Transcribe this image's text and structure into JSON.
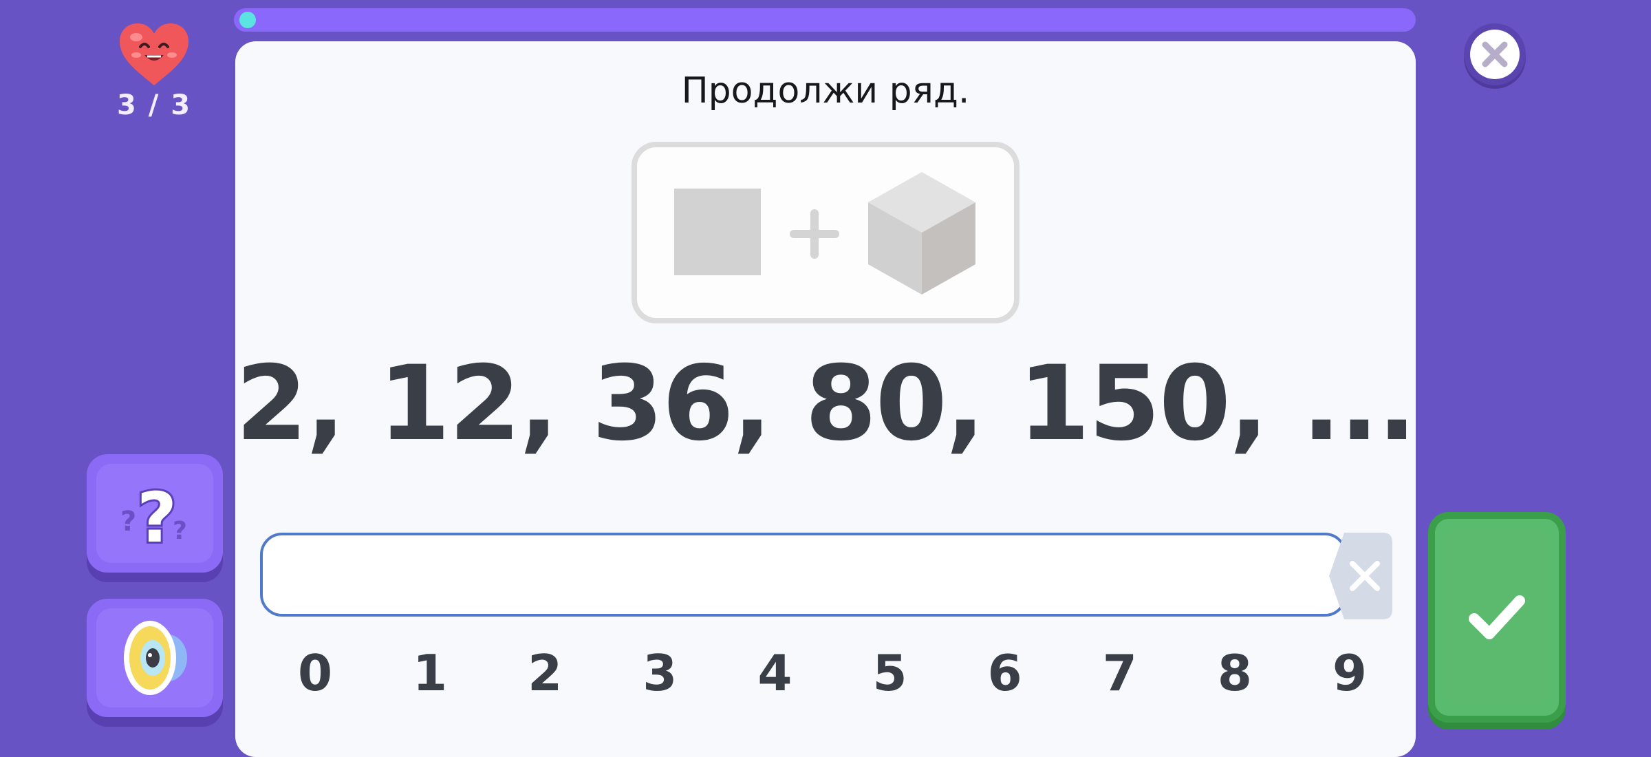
{
  "progress": {
    "value_fraction": 0.0
  },
  "lives": {
    "count_text": "3 / 3",
    "icon": "smiling-heart-icon"
  },
  "question": {
    "prompt": "Продолжи ряд.",
    "hint_image": [
      "square-icon",
      "plus-icon",
      "cube-icon"
    ],
    "sequence": "2, 12, 36, 80, 150, ..."
  },
  "answer": {
    "value": "",
    "placeholder": ""
  },
  "keypad": {
    "digits": [
      "0",
      "1",
      "2",
      "3",
      "4",
      "5",
      "6",
      "7",
      "8",
      "9"
    ]
  },
  "buttons": {
    "close": "close-icon",
    "help": "question-marks-icon",
    "sound": "speaker-icon",
    "backspace": "backspace-icon",
    "submit": "checkmark-icon"
  },
  "colors": {
    "background": "#6853c4",
    "progress_track": "#8a68fb",
    "progress_fill": "#5ae3e0",
    "card": "#f8f9fd",
    "input_border": "#4f7acb",
    "submit": "#59bb6d",
    "side_button": "#8b6bf5"
  }
}
